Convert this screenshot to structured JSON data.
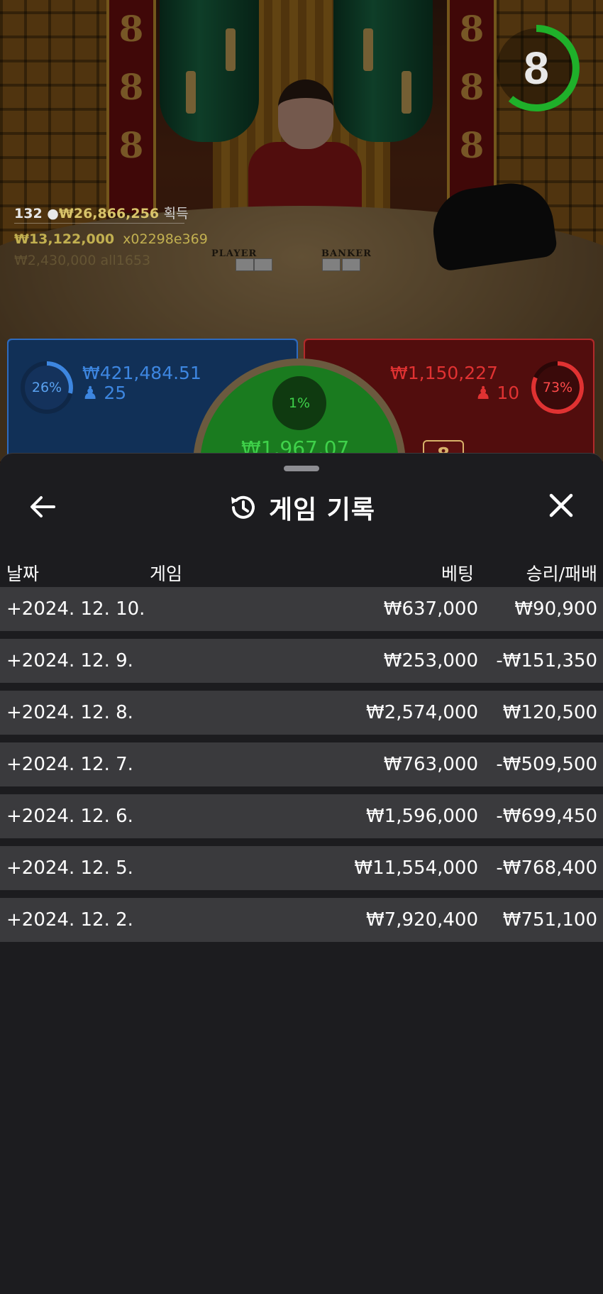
{
  "game_view": {
    "timer_value": "8",
    "stats": {
      "players": "132",
      "total_win": "₩26,866,256",
      "win_label": "획득",
      "top_win": "₩13,122,000",
      "top_win_id": "x02298e369",
      "second_win_faded": "₩2,430,000  all1653"
    },
    "table_labels": {
      "player": "PLAYER",
      "banker": "BANKER"
    },
    "player_panel": {
      "percent": "26%",
      "percent_value": 0.26,
      "amount": "₩421,484.51",
      "count": "25",
      "color": "#2e6bbf"
    },
    "banker_panel": {
      "percent": "73%",
      "percent_value": 0.73,
      "amount": "₩1,150,227",
      "count": "10",
      "color": "#d22a2a"
    },
    "tie_panel": {
      "percent": "1%",
      "amount": "₩1,967.07",
      "color": "#3fd14a"
    },
    "banker_score": "8"
  },
  "sheet": {
    "title": "게임 기록",
    "title_icon": "history-icon",
    "back_icon": "arrow-left-icon",
    "close_icon": "close-icon",
    "columns": {
      "date": "날짜",
      "game": "게임",
      "bet": "베팅",
      "result": "승리/패배"
    },
    "rows": [
      {
        "date": "+2024. 12. 10.",
        "bet": "₩637,000",
        "result": "₩90,900"
      },
      {
        "date": "+2024. 12. 9.",
        "bet": "₩253,000",
        "result": "-₩151,350"
      },
      {
        "date": "+2024. 12. 8.",
        "bet": "₩2,574,000",
        "result": "₩120,500"
      },
      {
        "date": "+2024. 12. 7.",
        "bet": "₩763,000",
        "result": "-₩509,500"
      },
      {
        "date": "+2024. 12. 6.",
        "bet": "₩1,596,000",
        "result": "-₩699,450"
      },
      {
        "date": "+2024. 12. 5.",
        "bet": "₩11,554,000",
        "result": "-₩768,400"
      },
      {
        "date": "+2024. 12. 2.",
        "bet": "₩7,920,400",
        "result": "₩751,100"
      }
    ]
  }
}
